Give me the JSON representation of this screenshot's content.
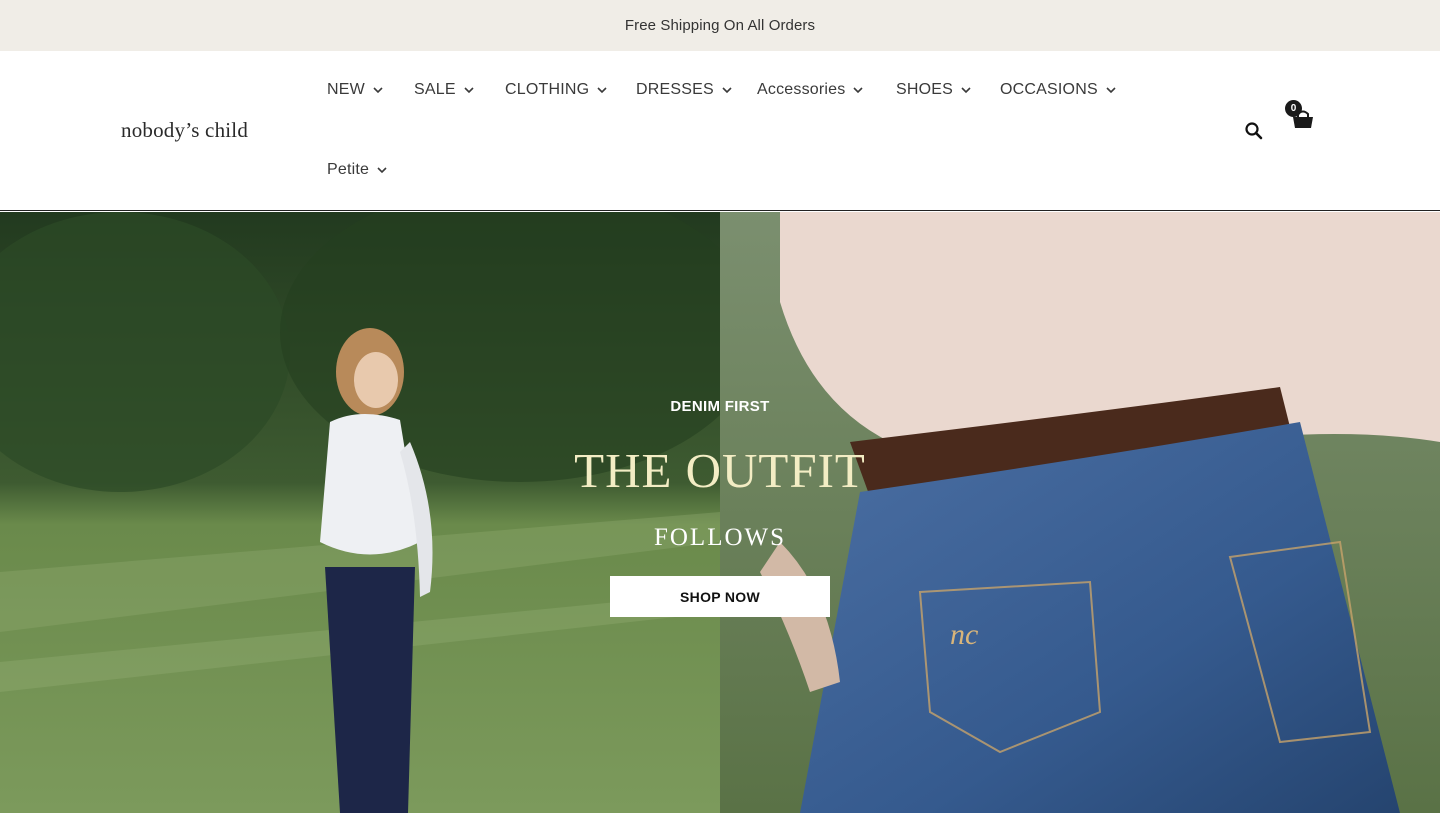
{
  "announcement": {
    "text": "Free Shipping On All Orders"
  },
  "header": {
    "logo": "nobody’s child",
    "nav": [
      {
        "label": "NEW"
      },
      {
        "label": "SALE"
      },
      {
        "label": "CLOTHING"
      },
      {
        "label": "DRESSES"
      },
      {
        "label": "Accessories"
      },
      {
        "label": "SHOES"
      },
      {
        "label": "OCCASIONS"
      },
      {
        "label": "Petite"
      }
    ],
    "search_icon": "search-icon",
    "cart": {
      "icon": "cart-icon",
      "count": "0"
    }
  },
  "hero": {
    "eyebrow": "DENIM FIRST",
    "headline": "THE OUTFIT",
    "subhead": "FOLLOWS",
    "cta_label": "SHOP NOW",
    "colors": {
      "headline": "#f3edc4",
      "button_bg": "#ffffff"
    }
  },
  "colors": {
    "announcement_bg": "#f0ede7",
    "text": "#3a3a3a"
  }
}
